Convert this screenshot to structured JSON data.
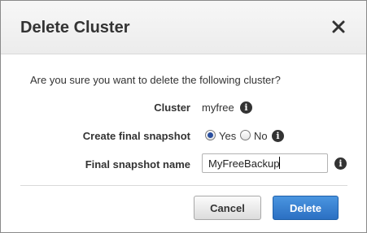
{
  "dialog": {
    "title": "Delete Cluster",
    "prompt": "Are you sure you want to delete the following cluster?",
    "cluster_label": "Cluster",
    "cluster_value": "myfree",
    "snapshot_label": "Create final snapshot",
    "snapshot_options": [
      "Yes",
      "No"
    ],
    "snapshot_selected": "Yes",
    "snapshot_name_label": "Final snapshot name",
    "snapshot_name_value": "MyFreeBackup",
    "cancel_label": "Cancel",
    "delete_label": "Delete"
  },
  "icons": {
    "close": "close-icon",
    "info": "info-icon",
    "info_glyph": "i"
  },
  "colors": {
    "primary_button": "#2b6fc2",
    "radio_selected": "#2a4f9e"
  }
}
